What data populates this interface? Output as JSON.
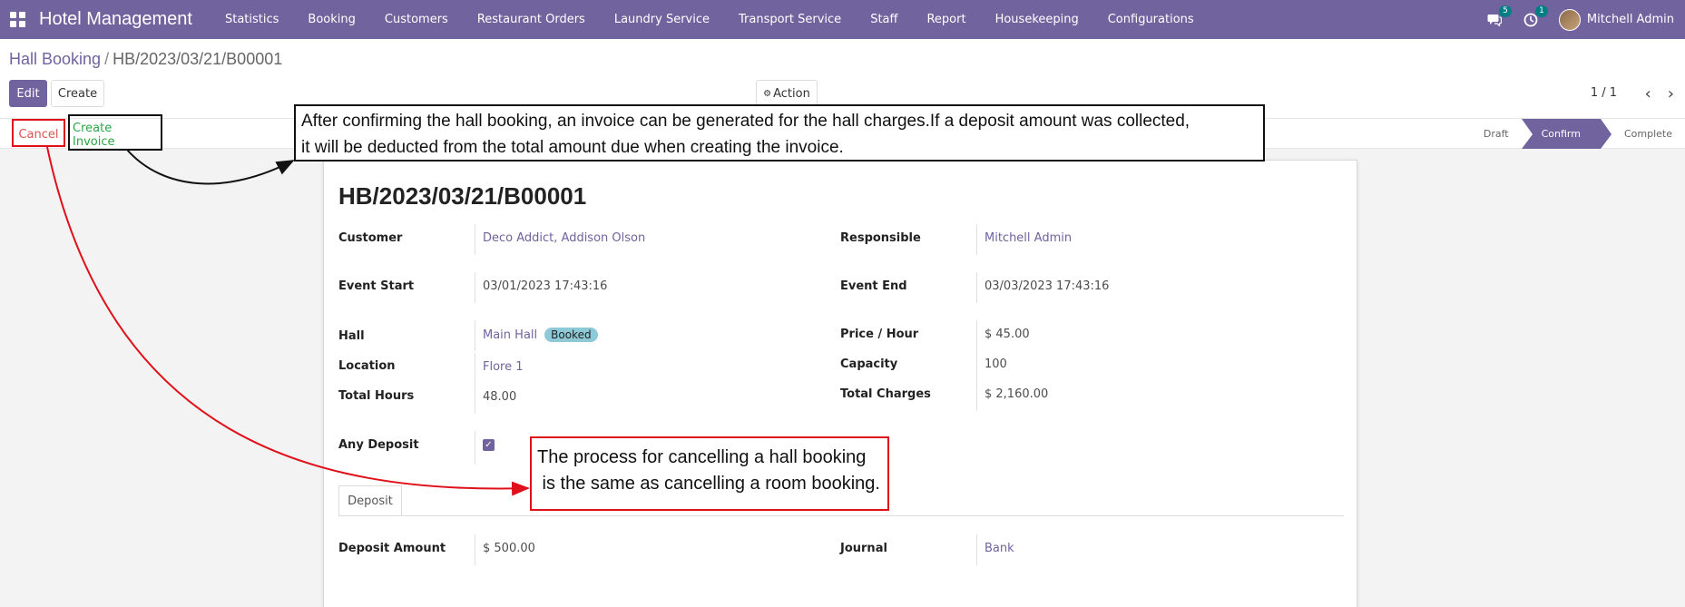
{
  "navbar": {
    "app_title": "Hotel Management",
    "menu": [
      "Statistics",
      "Booking",
      "Customers",
      "Restaurant Orders",
      "Laundry Service",
      "Transport Service",
      "Staff",
      "Report",
      "Housekeeping",
      "Configurations"
    ],
    "messages_count": "5",
    "activities_count": "1",
    "user_name": "Mitchell Admin",
    "bg_color": "#71639e"
  },
  "breadcrumb": {
    "parent": "Hall Booking",
    "separator": "/",
    "current": "HB/2023/03/21/B00001"
  },
  "control": {
    "edit_label": "Edit",
    "create_label": "Create",
    "action_label": "Action",
    "pager": "1 / 1"
  },
  "statusbar": {
    "cancel_label": "Cancel",
    "create_invoice_label": "Create Invoice",
    "stages": [
      "Draft",
      "Confirm",
      "Complete"
    ],
    "active_stage": "Confirm"
  },
  "record": {
    "title": "HB/2023/03/21/B00001",
    "customer_label": "Customer",
    "customer_value": "Deco Addict, Addison Olson",
    "responsible_label": "Responsible",
    "responsible_value": "Mitchell Admin",
    "event_start_label": "Event Start",
    "event_start_value": "03/01/2023 17:43:16",
    "event_end_label": "Event End",
    "event_end_value": "03/03/2023 17:43:16",
    "hall_label": "Hall",
    "hall_value": "Main Hall",
    "hall_tag": "Booked",
    "price_label": "Price / Hour",
    "price_value": "$ 45.00",
    "location_label": "Location",
    "location_value": "Flore 1",
    "capacity_label": "Capacity",
    "capacity_value": "100",
    "total_hours_label": "Total Hours",
    "total_hours_value": "48.00",
    "total_charges_label": "Total Charges",
    "total_charges_value": "$ 2,160.00",
    "any_deposit_label": "Any Deposit",
    "any_deposit_checked": true,
    "tab_label": "Deposit",
    "deposit_amount_label": "Deposit Amount",
    "deposit_amount_value": "$ 500.00",
    "journal_label": "Journal",
    "journal_value": "Bank"
  },
  "annotations": {
    "invoice_line1": "After confirming the hall booking, an invoice can be generated for the hall charges.If a deposit amount was collected,",
    "invoice_line2": "it will be deducted from the total amount due when creating the invoice.",
    "cancel_text": "The process for cancelling a hall booking\n is the same as cancelling a room booking."
  }
}
